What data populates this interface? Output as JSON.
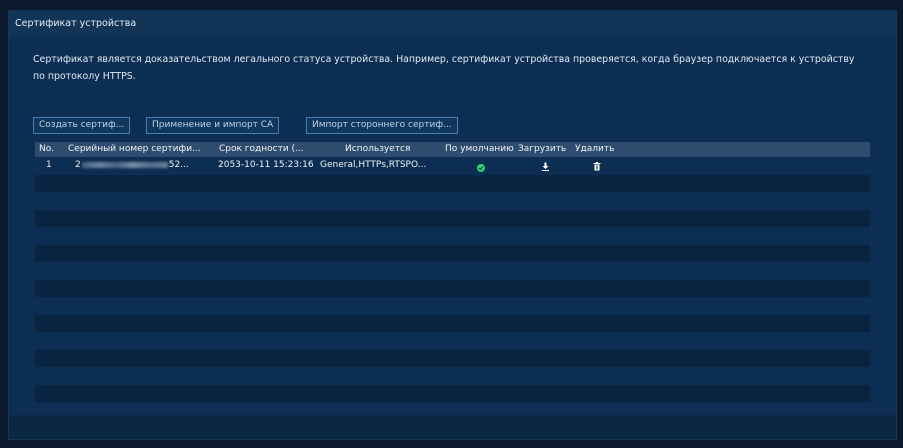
{
  "header": {
    "title": "Сертификат устройства"
  },
  "description": {
    "line1": "Сертификат является доказательством легального статуса устройства. Например, сертификат устройства проверяется, когда браузер подключается к устройству",
    "line2": "по протоколу HTTPS."
  },
  "buttons": {
    "create": "Создать сертиф...",
    "apply_ca": "Применение и импорт CA",
    "import_third": "Импорт стороннего сертиф..."
  },
  "table": {
    "headers": {
      "no": "No.",
      "serial": "Серийный номер сертифи...",
      "expiry": "Срок годности (...",
      "used": "Используется",
      "default": "По умолчанию",
      "download": "Загрузить",
      "delete": "Удалить"
    },
    "rows": [
      {
        "no": "1",
        "serial_prefix": "2",
        "serial_suffix": "52...",
        "expiry": "2053-10-11 15:23:16",
        "used": "General,HTTPs,RTSPO...",
        "default_icon": "check-circle-icon",
        "download_icon": "download-icon",
        "delete_icon": "trash-icon"
      }
    ]
  },
  "colors": {
    "accent_green": "#2bd66a",
    "button_border": "#4d7db0"
  }
}
